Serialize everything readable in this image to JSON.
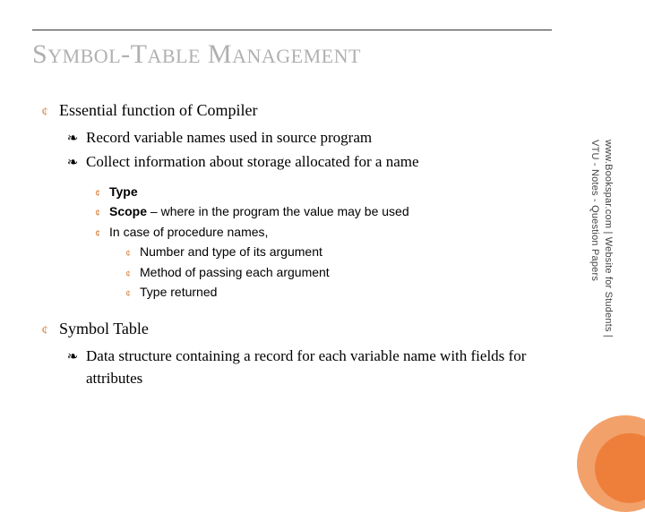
{
  "title": {
    "parts": [
      "S",
      "YMBOL",
      "-T",
      "ABLE",
      " M",
      "ANAGEMENT"
    ]
  },
  "items": {
    "l1a": "Essential function of Compiler",
    "l2a": "Record variable names used in source program",
    "l2b": "Collect information about storage allocated for a name",
    "l3a_bold": "Type",
    "l3b_bold": "Scope",
    "l3b_rest": " – where in the program the value may be used",
    "l3c": "In case of procedure names,",
    "l4a": "Number and type of its argument",
    "l4b": "Method of passing each argument",
    "l4c": "Type returned",
    "l1b": "Symbol Table",
    "l2c": "Data structure containing a record for each variable name with fields for attributes"
  },
  "sidebar": {
    "line1": "www.Bookspar.com | Website for Students |",
    "line2": "VTU - Notes - Question Papers"
  },
  "bullets": {
    "b1": "¢",
    "b2": "❧",
    "b3": "¢",
    "b4": "¢"
  }
}
